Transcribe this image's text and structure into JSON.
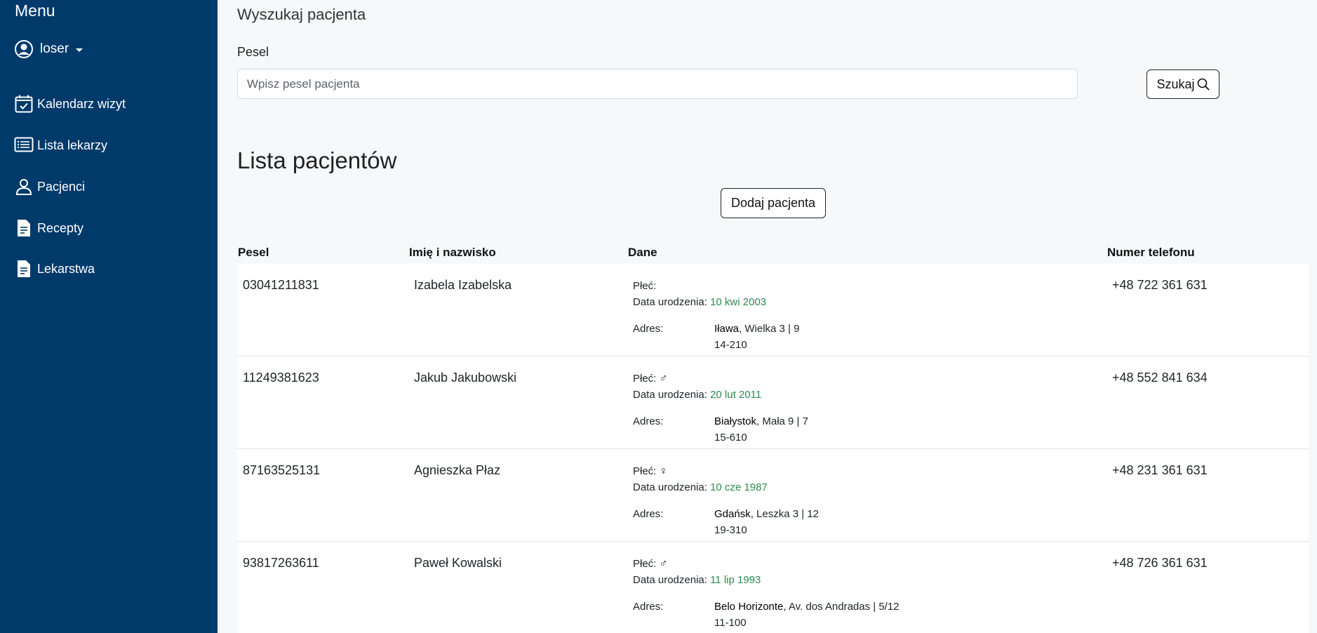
{
  "sidebar": {
    "title": "Menu",
    "user": "loser",
    "items": [
      {
        "label": "Kalendarz wizyt"
      },
      {
        "label": "Lista lekarzy"
      },
      {
        "label": "Pacjenci"
      },
      {
        "label": "Recepty"
      },
      {
        "label": "Lekarstwa"
      }
    ]
  },
  "search": {
    "heading": "Wyszukaj pacjenta",
    "field_label": "Pesel",
    "placeholder": "Wpisz pesel pacjenta",
    "value": "",
    "button_label": "Szukaj"
  },
  "list": {
    "heading": "Lista pacjentów",
    "add_button": "Dodaj pacjenta",
    "columns": {
      "pesel": "Pesel",
      "name": "Imię i nazwisko",
      "data": "Dane",
      "phone": "Numer telefonu"
    },
    "labels": {
      "gender": "Płeć:",
      "birth": "Data urodzenia:",
      "address": "Adres:"
    },
    "rows": [
      {
        "pesel": "03041211831",
        "name": "Izabela Izabelska",
        "gender": "",
        "birth": "10 kwi 2003",
        "city": "Iława",
        "street": ", Wielka 3 | 9",
        "postal": "14-210",
        "phone": "+48 722 361 631"
      },
      {
        "pesel": "11249381623",
        "name": "Jakub Jakubowski",
        "gender": "♂",
        "birth": "20 lut 2011",
        "city": "Białystok",
        "street": ", Mała 9 | 7",
        "postal": "15-610",
        "phone": "+48 552 841 634"
      },
      {
        "pesel": "87163525131",
        "name": "Agnieszka Płaz",
        "gender": "♀",
        "birth": "10 cze 1987",
        "city": "Gdańsk",
        "street": ", Leszka 3 | 12",
        "postal": "19-310",
        "phone": "+48 231 361 631"
      },
      {
        "pesel": "93817263611",
        "name": "Paweł Kowalski",
        "gender": "♂",
        "birth": "11 lip 1993",
        "city": "Belo Horizonte",
        "street": ", Av. dos Andradas | 5/12",
        "postal": "11-100",
        "phone": "+48 726 361 631"
      }
    ]
  },
  "colors": {
    "sidebar_bg": "#003a6b",
    "date_green": "#2d8a4d"
  },
  "icons": [
    "user-circle-icon",
    "calendar-check-icon",
    "list-icon",
    "person-icon",
    "document-icon",
    "search-icon",
    "male-icon",
    "female-icon"
  ]
}
